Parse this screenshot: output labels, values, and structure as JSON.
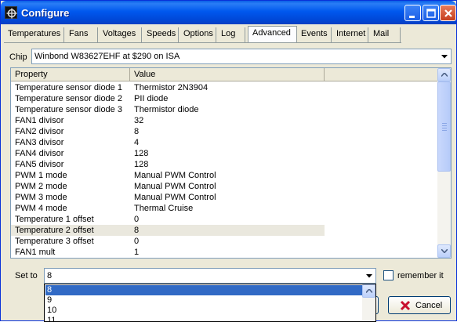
{
  "window": {
    "title": "Configure",
    "icon": "app-gear-icon"
  },
  "titlebar_buttons": [
    "minimize-icon",
    "maximize-icon",
    "close-icon"
  ],
  "tabs": [
    {
      "label": "Temperatures",
      "active": false
    },
    {
      "label": "Fans",
      "active": false
    },
    {
      "label": "Voltages",
      "active": false
    },
    {
      "label": "Speeds",
      "active": false
    },
    {
      "label": "Options",
      "active": false
    },
    {
      "label": "Log",
      "active": false
    },
    {
      "label": "Advanced",
      "active": true
    },
    {
      "label": "Events",
      "active": false
    },
    {
      "label": "Internet",
      "active": false
    },
    {
      "label": "Mail",
      "active": false
    }
  ],
  "chip": {
    "label": "Chip",
    "value": "Winbond W83627EHF at $290 on ISA"
  },
  "grid": {
    "columns": [
      "Property",
      "Value",
      ""
    ],
    "rows": [
      {
        "property": "Temperature sensor diode 1",
        "value": "Thermistor 2N3904"
      },
      {
        "property": "Temperature sensor diode 2",
        "value": "PII diode"
      },
      {
        "property": "Temperature sensor diode 3",
        "value": "Thermistor diode"
      },
      {
        "property": "FAN1 divisor",
        "value": "32"
      },
      {
        "property": "FAN2 divisor",
        "value": "8"
      },
      {
        "property": "FAN3 divisor",
        "value": "4"
      },
      {
        "property": "FAN4 divisor",
        "value": "128"
      },
      {
        "property": "FAN5 divisor",
        "value": "128"
      },
      {
        "property": "PWM 1 mode",
        "value": "Manual PWM Control"
      },
      {
        "property": "PWM 2 mode",
        "value": "Manual PWM Control"
      },
      {
        "property": "PWM 3 mode",
        "value": "Manual PWM Control"
      },
      {
        "property": "PWM 4 mode",
        "value": "Thermal Cruise"
      },
      {
        "property": "Temperature 1 offset",
        "value": "0"
      },
      {
        "property": "Temperature 2 offset",
        "value": "8",
        "selected": true
      },
      {
        "property": "Temperature 3 offset",
        "value": "0"
      },
      {
        "property": "FAN1 mult",
        "value": "1"
      }
    ]
  },
  "set_to": {
    "label": "Set to",
    "value": "8"
  },
  "remember": {
    "label": "remember it",
    "checked": false
  },
  "dropdown": {
    "options": [
      "8",
      "9",
      "10",
      "11"
    ],
    "selected": "8"
  },
  "buttons": {
    "cancel": "Cancel"
  },
  "colors": {
    "selection": "#316ac5",
    "title_bar": "#0058ee",
    "cancel_icon": "#c8102e"
  }
}
